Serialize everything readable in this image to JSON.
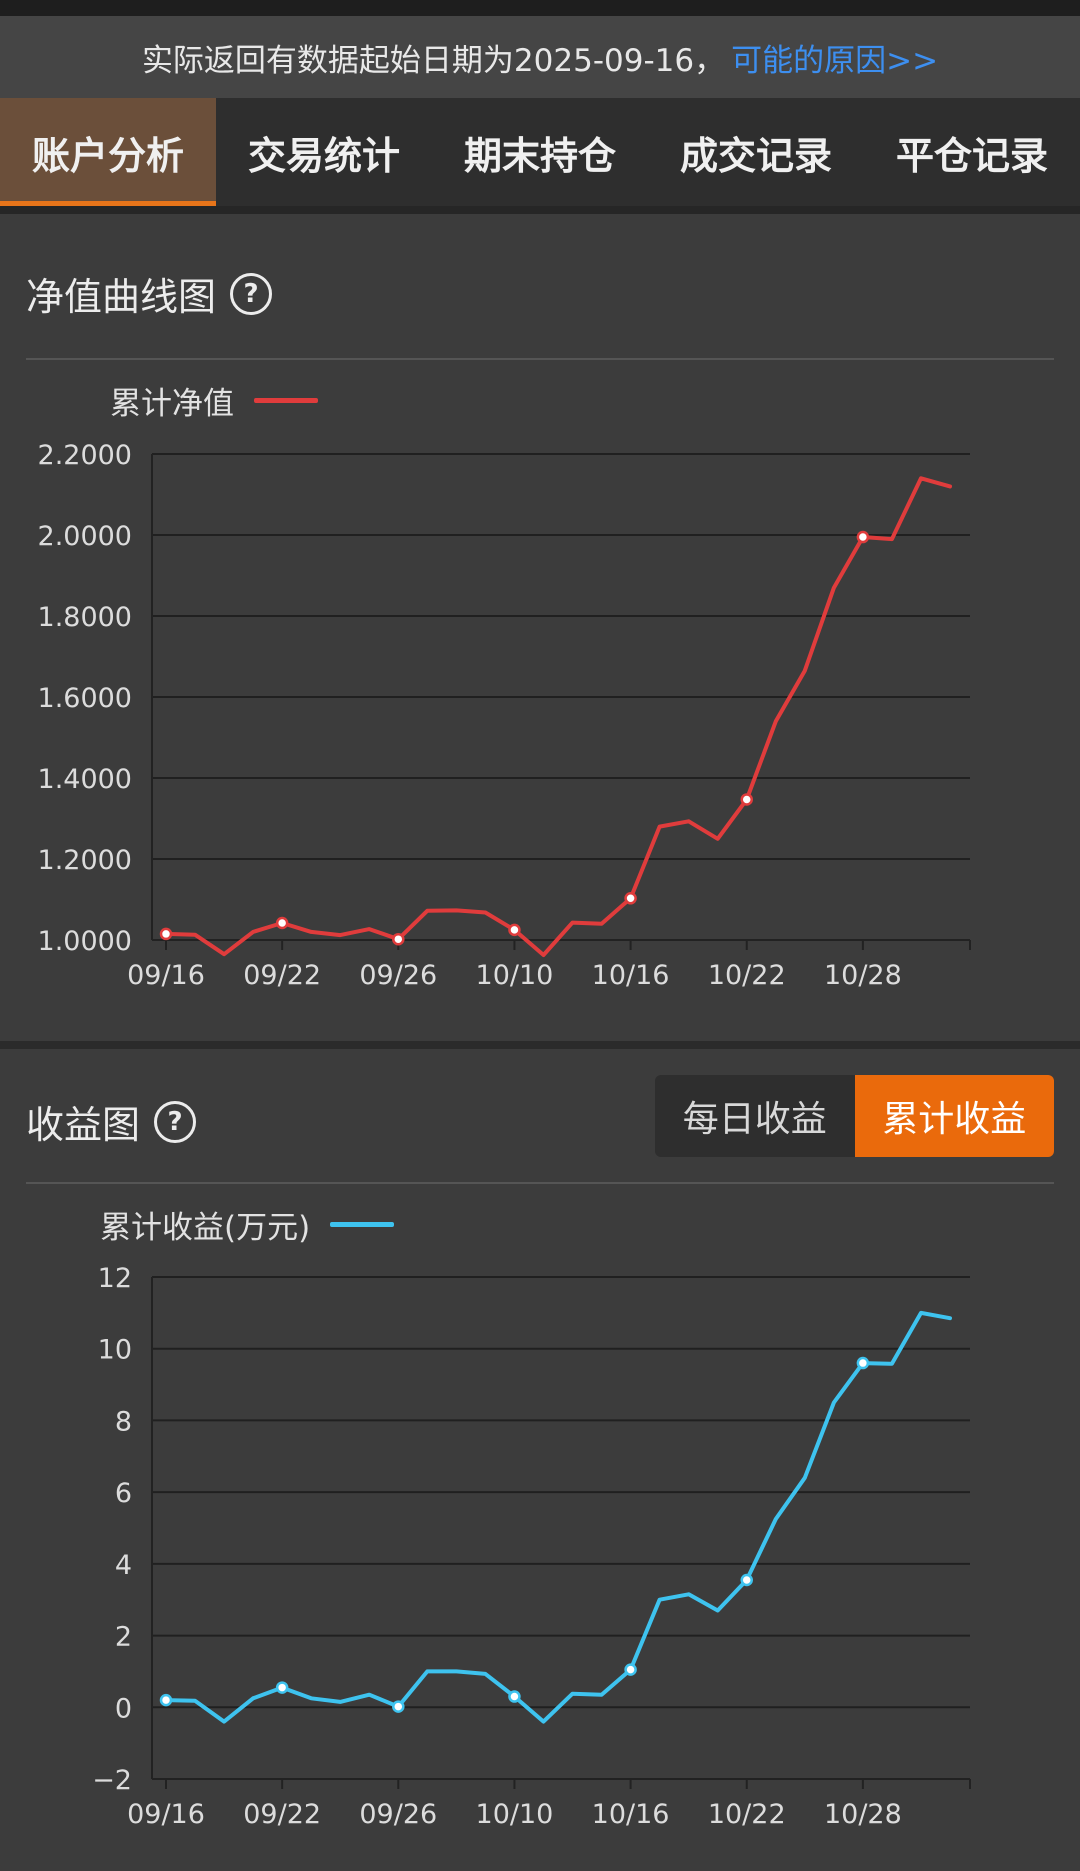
{
  "notice": {
    "text": "实际返回有数据起始日期为2025-09-16，",
    "link": "可能的原因>>"
  },
  "tabs": [
    "账户分析",
    "交易统计",
    "期末持仓",
    "成交记录",
    "平仓记录"
  ],
  "nav_section": {
    "title": "净值曲线图",
    "help": "?"
  },
  "profit_section": {
    "title": "收益图",
    "help": "?",
    "toggle": {
      "daily": "每日收益",
      "cumulative": "累计收益"
    }
  },
  "colors": {
    "accent": "#ea6a0c",
    "nav_line": "#e03c3c",
    "profit_line": "#3ec3ef",
    "link": "#3d8ff0"
  },
  "chart_data": [
    {
      "type": "line",
      "legend_position": "top-left",
      "grid": true,
      "ylim": [
        1.0,
        2.2
      ],
      "yticks": [
        "2.2000",
        "2.0000",
        "1.8000",
        "1.6000",
        "1.4000",
        "1.2000",
        "1.0000"
      ],
      "ytick_values": [
        2.2,
        2.0,
        1.8,
        1.6,
        1.4,
        1.2,
        1.0
      ],
      "xticks": [
        "09/16",
        "09/22",
        "09/26",
        "10/10",
        "10/16",
        "10/22",
        "10/28"
      ],
      "xtick_index": [
        0,
        4,
        8,
        12,
        16,
        20,
        24
      ],
      "markers": [
        0,
        4,
        8,
        12,
        16,
        20,
        24
      ],
      "series": [
        {
          "name": "累计净值",
          "values": [
            1.015,
            1.013,
            0.965,
            1.02,
            1.042,
            1.02,
            1.012,
            1.027,
            1.002,
            1.072,
            1.073,
            1.068,
            1.025,
            0.963,
            1.043,
            1.04,
            1.103,
            1.28,
            1.293,
            1.25,
            1.347,
            1.54,
            1.665,
            1.87,
            1.995,
            1.99,
            2.14,
            2.12
          ]
        }
      ]
    },
    {
      "type": "line",
      "legend_position": "top-left",
      "grid": true,
      "ylim": [
        -2,
        12
      ],
      "yticks": [
        "12",
        "10",
        "8",
        "6",
        "4",
        "2",
        "0",
        "−2"
      ],
      "ytick_values": [
        12,
        10,
        8,
        6,
        4,
        2,
        0,
        -2
      ],
      "xticks": [
        "09/16",
        "09/22",
        "09/26",
        "10/10",
        "10/16",
        "10/22",
        "10/28"
      ],
      "xtick_index": [
        0,
        4,
        8,
        12,
        16,
        20,
        24
      ],
      "markers": [
        0,
        4,
        8,
        12,
        16,
        20,
        24
      ],
      "series": [
        {
          "name": "累计收益(万元)",
          "values": [
            0.2,
            0.18,
            -0.4,
            0.25,
            0.55,
            0.25,
            0.15,
            0.35,
            0.02,
            1.0,
            1.0,
            0.93,
            0.3,
            -0.4,
            0.38,
            0.35,
            1.05,
            3.0,
            3.15,
            2.7,
            3.55,
            5.25,
            6.4,
            8.5,
            9.6,
            9.58,
            11.0,
            10.85
          ]
        }
      ]
    }
  ]
}
